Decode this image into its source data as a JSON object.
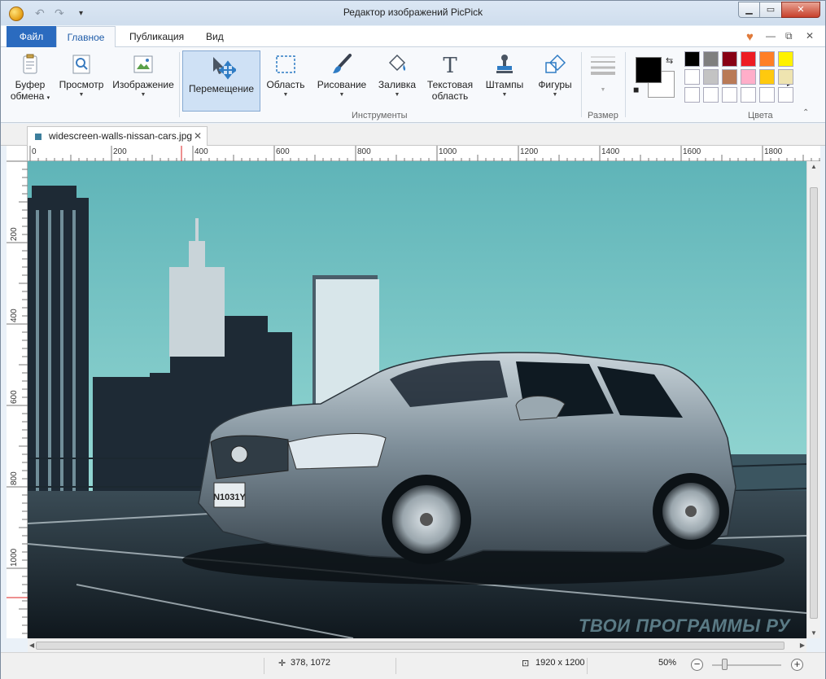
{
  "window": {
    "title": "Редактор изображений PicPick"
  },
  "quick_access": {
    "undo_icon": "↶",
    "redo_icon": "↷",
    "customize_icon": "▾"
  },
  "window_buttons": {
    "minimize": "▁",
    "maximize": "▭",
    "close": "✕"
  },
  "tabs": [
    {
      "label": "Файл"
    },
    {
      "label": "Главное"
    },
    {
      "label": "Публикация"
    },
    {
      "label": "Вид"
    }
  ],
  "tab_controls": {
    "favorite_icon": "♥",
    "minimize_ribbon": "—",
    "restore": "⧉",
    "close": "✕"
  },
  "ribbon": {
    "clipboard": {
      "line1": "Буфер",
      "line2": "обмена"
    },
    "preview": "Просмотр",
    "image": "Изображение",
    "move": "Перемещение",
    "region": "Область",
    "draw": "Рисование",
    "fill": "Заливка",
    "textarea_line1": "Текстовая",
    "textarea_line2": "область",
    "stamps": "Штампы",
    "shapes": "Фигуры",
    "group_tools": "Инструменты",
    "group_size": "Размер",
    "group_colors": "Цвета",
    "colors": {
      "foreground": "#000000",
      "background": "#ffffff",
      "palette_row1": [
        "#000000",
        "#7f7f7f",
        "#880015",
        "#ed1c24",
        "#ff7f27",
        "#fff200"
      ],
      "palette_row2": [
        "#ffffff",
        "#c3c3c3",
        "#b97a57",
        "#ffaec9",
        "#ffc90e",
        "#efe4b0"
      ],
      "palette_row3": [
        "#ffffff",
        "#ffffff",
        "#ffffff",
        "#ffffff",
        "#ffffff",
        "#ffffff"
      ]
    }
  },
  "document": {
    "tab_label": "widescreen-walls-nissan-cars.jpg"
  },
  "ruler": {
    "h_labels": [
      "0",
      "200",
      "400",
      "600",
      "800",
      "1000",
      "1200",
      "1400",
      "1600",
      "1800"
    ],
    "v_labels": [
      "200",
      "400",
      "600",
      "800",
      "1000"
    ]
  },
  "canvas": {
    "plate": "N1031Y",
    "watermark": "ТВОИ ПРОГРАММЫ РУ"
  },
  "status": {
    "cursor": "378, 1072",
    "image_size": "1920 x 1200",
    "zoom": "50%"
  }
}
